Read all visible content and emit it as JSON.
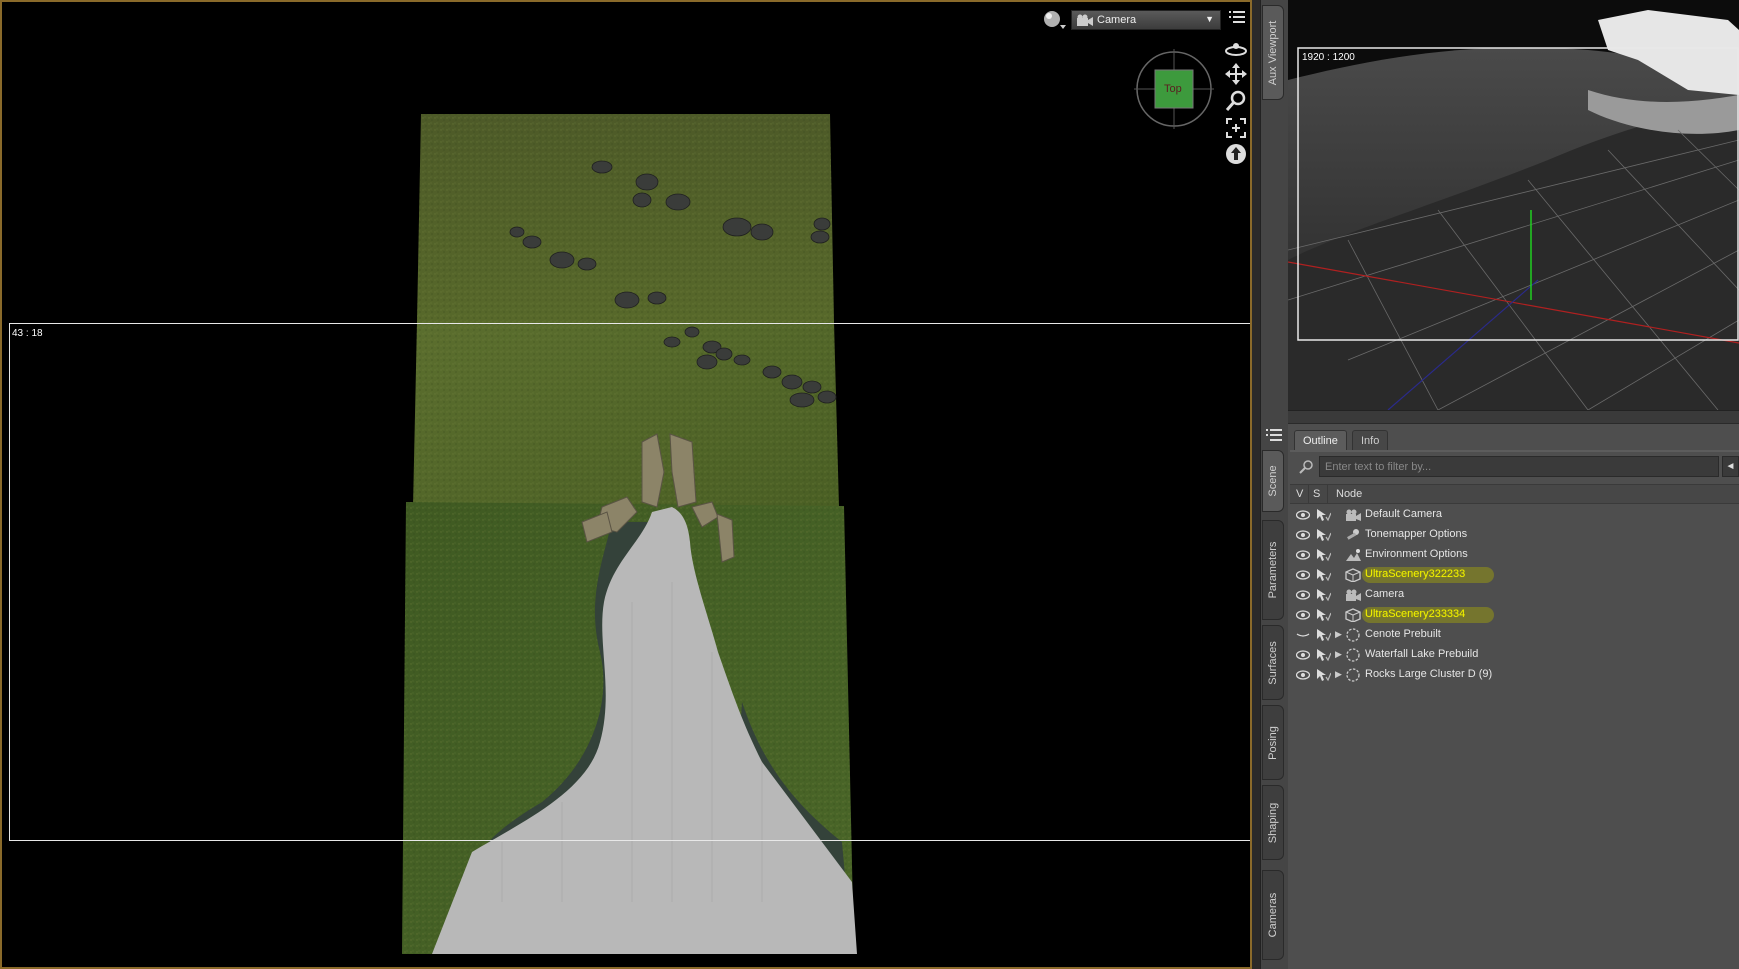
{
  "viewport": {
    "camera_select": "Camera",
    "aspect_label": "43 : 18",
    "cube_face": "Top",
    "icons": [
      "draw-style-sphere-icon",
      "viewport-menu-icon",
      "orbit-icon",
      "pan-icon",
      "zoom-icon",
      "frame-icon",
      "reset-icon"
    ]
  },
  "side_tabs": {
    "aux_viewport": "Aux Viewport",
    "scene": "Scene",
    "parameters": "Parameters",
    "surfaces": "Surfaces",
    "posing": "Posing",
    "shaping": "Shaping",
    "cameras": "Cameras"
  },
  "aux": {
    "resolution": "1920 : 1200"
  },
  "scene": {
    "tabs": [
      {
        "label": "Outline",
        "active": true
      },
      {
        "label": "Info",
        "active": false
      }
    ],
    "filter_placeholder": "Enter text to filter by...",
    "filter_button": "◄",
    "columns": {
      "v": "V",
      "s": "S",
      "node": "Node"
    },
    "nodes": [
      {
        "label": "Default Camera",
        "icon": "camera-icon",
        "highlighted": false,
        "expandable": false,
        "visible": true
      },
      {
        "label": "Tonemapper Options",
        "icon": "tonemapper-icon",
        "highlighted": false,
        "expandable": false,
        "visible": true
      },
      {
        "label": "Environment Options",
        "icon": "environment-icon",
        "highlighted": false,
        "expandable": false,
        "visible": true
      },
      {
        "label": "UltraScenery322233",
        "icon": "scenery-cube-icon",
        "highlighted": true,
        "expandable": false,
        "visible": true
      },
      {
        "label": "Camera",
        "icon": "camera-icon",
        "highlighted": false,
        "expandable": false,
        "visible": true
      },
      {
        "label": "UltraScenery233334",
        "icon": "scenery-cube-icon",
        "highlighted": true,
        "expandable": false,
        "visible": true
      },
      {
        "label": "Cenote Prebuilt",
        "icon": "group-node-icon",
        "highlighted": false,
        "expandable": true,
        "visible": false
      },
      {
        "label": "Waterfall Lake Prebuild",
        "icon": "group-node-icon",
        "highlighted": false,
        "expandable": true,
        "visible": true
      },
      {
        "label": "Rocks Large Cluster D (9)",
        "icon": "group-node-icon",
        "highlighted": false,
        "expandable": true,
        "visible": true
      }
    ]
  },
  "colors": {
    "viewport_border": "#8a6a2a",
    "grass": "#4a5a24",
    "water": "#b4b4b4",
    "highlight_text": "#f0f000"
  }
}
